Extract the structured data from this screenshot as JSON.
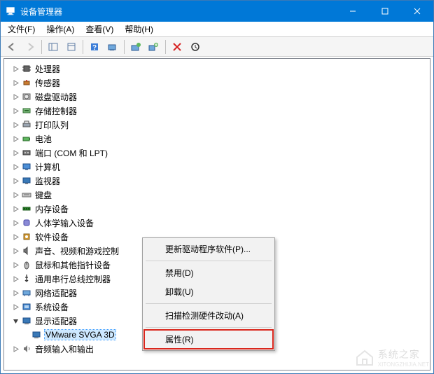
{
  "window": {
    "title": "设备管理器"
  },
  "menubar": {
    "file": "文件(F)",
    "action": "操作(A)",
    "view": "查看(V)",
    "help": "帮助(H)"
  },
  "tree": {
    "items": [
      {
        "icon": "cpu",
        "label": "处理器",
        "expander": ">"
      },
      {
        "icon": "sensor",
        "label": "传感器",
        "expander": ">"
      },
      {
        "icon": "disk",
        "label": "磁盘驱动器",
        "expander": ">"
      },
      {
        "icon": "storage",
        "label": "存储控制器",
        "expander": ">"
      },
      {
        "icon": "printqueue",
        "label": "打印队列",
        "expander": ">"
      },
      {
        "icon": "battery",
        "label": "电池",
        "expander": ">"
      },
      {
        "icon": "port",
        "label": "端口 (COM 和 LPT)",
        "expander": ">"
      },
      {
        "icon": "computer",
        "label": "计算机",
        "expander": ">"
      },
      {
        "icon": "monitor",
        "label": "监视器",
        "expander": ">"
      },
      {
        "icon": "keyboard",
        "label": "键盘",
        "expander": ">"
      },
      {
        "icon": "memory",
        "label": "内存设备",
        "expander": ">"
      },
      {
        "icon": "hid",
        "label": "人体学输入设备",
        "expander": ">"
      },
      {
        "icon": "software",
        "label": "软件设备",
        "expander": ">"
      },
      {
        "icon": "sound",
        "label": "声音、视频和游戏控制",
        "expander": ">"
      },
      {
        "icon": "mouse",
        "label": "鼠标和其他指针设备",
        "expander": ">"
      },
      {
        "icon": "usb",
        "label": "通用串行总线控制器",
        "expander": ">"
      },
      {
        "icon": "network",
        "label": "网络适配器",
        "expander": ">"
      },
      {
        "icon": "system",
        "label": "系统设备",
        "expander": ">"
      },
      {
        "icon": "display",
        "label": "显示适配器",
        "expander": "v",
        "expanded": true,
        "children": [
          {
            "icon": "display",
            "label": "VMware SVGA 3D",
            "selected": true
          }
        ]
      },
      {
        "icon": "audio",
        "label": "音频输入和输出",
        "expander": ">"
      }
    ]
  },
  "context_menu": {
    "update_driver": "更新驱动程序软件(P)...",
    "disable": "禁用(D)",
    "uninstall": "卸载(U)",
    "scan_hardware": "扫描检测硬件改动(A)",
    "properties": "属性(R)"
  },
  "watermark": {
    "text": "系统之家",
    "sub": "XITONGZHIJIA.NET"
  },
  "colors": {
    "title_bg": "#0078d7",
    "highlight_border": "#d9261c",
    "selection_bg": "#cde8ff"
  }
}
